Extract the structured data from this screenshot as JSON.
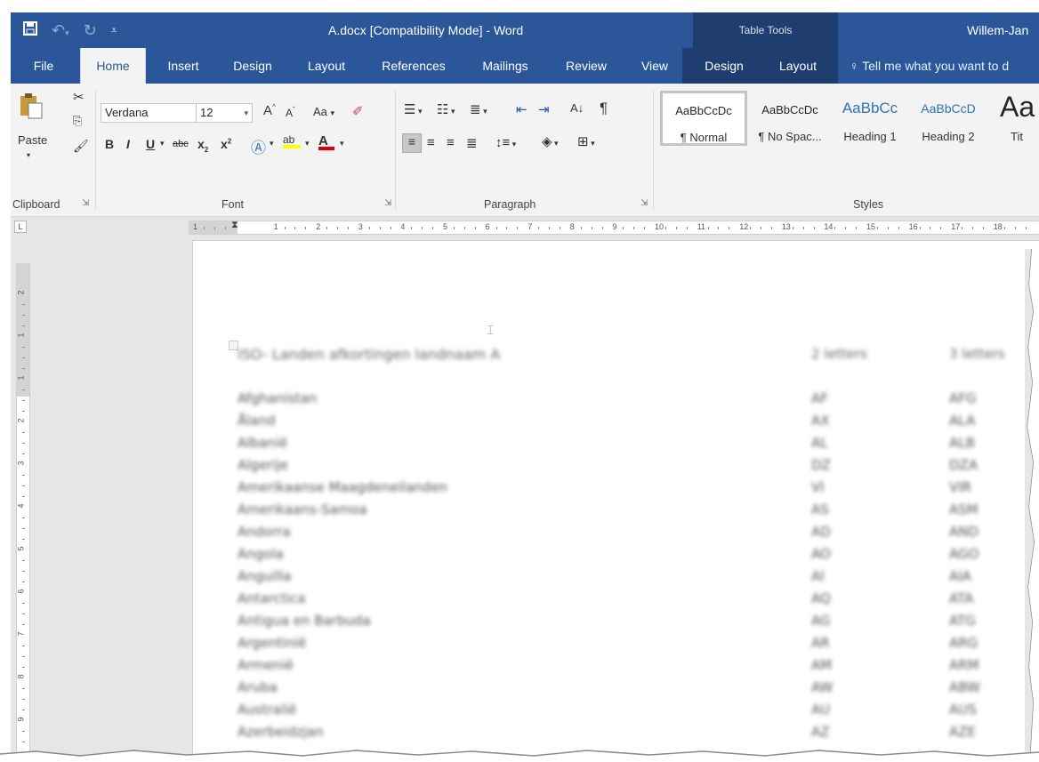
{
  "titlebar": {
    "doc_title": "A.docx [Compatibility Mode] - Word",
    "context_header": "Table Tools",
    "user_name": "Willem-Jan"
  },
  "tabs": {
    "file": "File",
    "home": "Home",
    "insert": "Insert",
    "design": "Design",
    "layout": "Layout",
    "references": "References",
    "mailings": "Mailings",
    "review": "Review",
    "view": "View",
    "table_design": "Design",
    "table_layout": "Layout",
    "tell_me": "Tell me what you want to d"
  },
  "ribbon": {
    "clipboard": {
      "label": "Clipboard",
      "paste_label": "Paste"
    },
    "font": {
      "label": "Font",
      "font_name": "Verdana",
      "font_size": "12",
      "change_case": "Aa"
    },
    "paragraph": {
      "label": "Paragraph"
    },
    "styles": {
      "label": "Styles",
      "items": [
        {
          "sample": "AaBbCcDc",
          "name": "¶ Normal"
        },
        {
          "sample": "AaBbCcDc",
          "name": "¶ No Spac..."
        },
        {
          "sample": "AaBbCc",
          "name": "Heading 1"
        },
        {
          "sample": "AaBbCcD",
          "name": "Heading 2"
        },
        {
          "sample": "Aa",
          "name": "Tit"
        }
      ]
    }
  },
  "ruler": {
    "tab_selector": "L",
    "h_numbers": [
      "1",
      "1",
      "2",
      "3",
      "4",
      "5",
      "6",
      "7",
      "8",
      "9",
      "10",
      "11",
      "12",
      "13",
      "14",
      "15",
      "16",
      "17",
      "18"
    ],
    "v_numbers": [
      "2",
      "1",
      "1",
      "2",
      "3",
      "4",
      "5",
      "6",
      "7",
      "8",
      "9"
    ]
  },
  "document": {
    "heading": "ISO- Landen afkortingen landnaam A",
    "col2_header": "2 letters",
    "col3_header": "3 letters",
    "rows": [
      {
        "name": "Afghanistan",
        "a2": "AF",
        "a3": "AFG"
      },
      {
        "name": "Åland",
        "a2": "AX",
        "a3": "ALA"
      },
      {
        "name": "Albanië",
        "a2": "AL",
        "a3": "ALB"
      },
      {
        "name": "Algerije",
        "a2": "DZ",
        "a3": "DZA"
      },
      {
        "name": "Amerikaanse Maagdeneilanden",
        "a2": "VI",
        "a3": "VIR"
      },
      {
        "name": "Amerikaans-Samoa",
        "a2": "AS",
        "a3": "ASM"
      },
      {
        "name": "Andorra",
        "a2": "AD",
        "a3": "AND"
      },
      {
        "name": "Angola",
        "a2": "AO",
        "a3": "AGO"
      },
      {
        "name": "Anguilla",
        "a2": "AI",
        "a3": "AIA"
      },
      {
        "name": "Antarctica",
        "a2": "AQ",
        "a3": "ATA"
      },
      {
        "name": "Antigua en Barbuda",
        "a2": "AG",
        "a3": "ATG"
      },
      {
        "name": "Argentinië",
        "a2": "AR",
        "a3": "ARG"
      },
      {
        "name": "Armenië",
        "a2": "AM",
        "a3": "ARM"
      },
      {
        "name": "Aruba",
        "a2": "AW",
        "a3": "ABW"
      },
      {
        "name": "Australië",
        "a2": "AU",
        "a3": "AUS"
      },
      {
        "name": "Azerbeidzjan",
        "a2": "AZ",
        "a3": "AZE"
      }
    ]
  },
  "colors": {
    "word_blue": "#2b579a",
    "context_blue": "#1f3e6f",
    "ribbon_bg": "#f3f3f3",
    "workspace_bg": "#e6e6e6"
  }
}
